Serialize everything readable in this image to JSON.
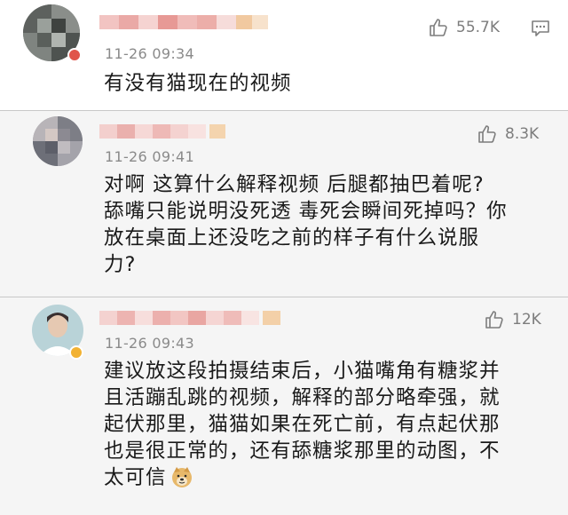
{
  "comments": [
    {
      "timestamp": "11-26 09:34",
      "likes": "55.7K",
      "lines": [
        "有没有猫现在的视频"
      ]
    },
    {
      "timestamp": "11-26 09:41",
      "likes": "8.3K",
      "lines": [
        "对啊 这算什么解释视频 后腿都抽巴着呢?",
        "舔嘴只能说明没死透 毒死会瞬间死掉吗？你",
        "放在桌面上还没吃之前的样子有什么说服",
        "力?"
      ]
    },
    {
      "timestamp": "11-26 09:43",
      "likes": "12K",
      "lines": [
        "建议放这段拍摄结束后，小猫嘴角有糖浆并",
        "且活蹦乱跳的视频，解释的部分略牵强，就",
        "起伏那里，猫猫如果在死亡前，有点起伏那",
        "也是很正常的，还有舔糖浆那里的动图，不",
        "太可信"
      ],
      "emoji": "doge-emoji"
    }
  ],
  "colors": {
    "text": "#1a1a1a",
    "meta": "#8a8a8a",
    "icon": "#7d7d7d",
    "alt_background": "#f5f5f5"
  }
}
